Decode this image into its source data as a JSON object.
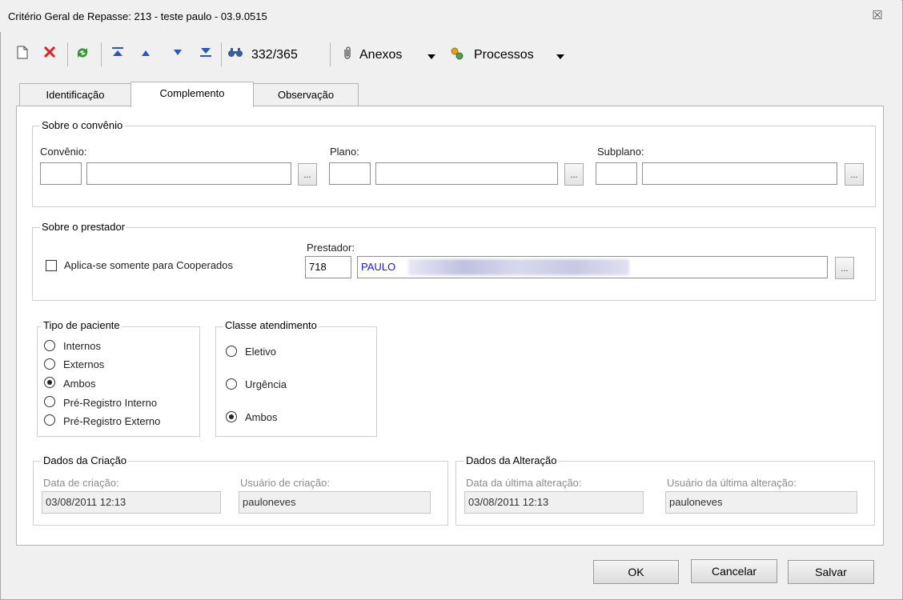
{
  "window": {
    "title": "Critério Geral de Repasse: 213 - teste paulo - 03.9.0515",
    "close_glyph": "☒"
  },
  "toolbar": {
    "record_counter": "332/365",
    "attachments_label": "Anexos",
    "processes_label": "Processos",
    "icons": [
      "new-icon",
      "delete-icon",
      "refresh-icon",
      "first-record-icon",
      "previous-record-icon",
      "next-record-icon",
      "last-record-icon",
      "search-icon",
      "paperclip-icon",
      "processes-icon"
    ]
  },
  "tabs": [
    {
      "label": "Identificação",
      "active": false
    },
    {
      "label": "Complemento",
      "active": true
    },
    {
      "label": "Observação",
      "active": false
    }
  ],
  "convenio_section": {
    "title": "Sobre o convênio",
    "convenio_label": "Convênio:",
    "plano_label": "Plano:",
    "subplano_label": "Subplano:",
    "ellipsis": "..."
  },
  "prestador_section": {
    "title": "Sobre o prestador",
    "checkbox_label": "Aplica-se somente para Cooperados",
    "checkbox_checked": false,
    "prestador_label": "Prestador:",
    "prestador_code": "718",
    "prestador_name": "PAULO",
    "ellipsis": "..."
  },
  "tipo_paciente": {
    "title": "Tipo de paciente",
    "options": [
      {
        "label": "Internos",
        "checked": false
      },
      {
        "label": "Externos",
        "checked": false
      },
      {
        "label": "Ambos",
        "checked": true
      },
      {
        "label": "Pré-Registro Interno",
        "checked": false
      },
      {
        "label": "Pré-Registro Externo",
        "checked": false
      }
    ]
  },
  "classe_atendimento": {
    "title": "Classe atendimento",
    "options": [
      {
        "label": "Eletivo",
        "checked": false
      },
      {
        "label": "Urgência",
        "checked": false
      },
      {
        "label": "Ambos",
        "checked": true
      }
    ]
  },
  "dados_criacao": {
    "title": "Dados da Criação",
    "date_label": "Data de criação:",
    "date_value": "03/08/2011 12:13",
    "user_label": "Usuário de criação:",
    "user_value": "pauloneves"
  },
  "dados_alteracao": {
    "title": "Dados da Alteração",
    "date_label": "Data da última alteração:",
    "date_value": "03/08/2011 12:13",
    "user_label": "Usuário da última alteração:",
    "user_value": "pauloneves"
  },
  "footer": {
    "ok_label": "OK",
    "cancel_label": "Cancelar",
    "save_label": "Salvar"
  }
}
